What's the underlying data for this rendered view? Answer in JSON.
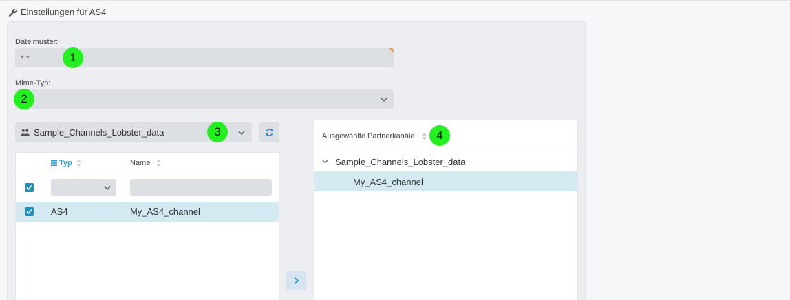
{
  "header": {
    "title": "Einstellungen für AS4",
    "icon": "wrench-icon"
  },
  "form": {
    "file_pattern": {
      "label": "Dateimuster:",
      "value": "*.*"
    },
    "mime_type": {
      "label": "Mime-Typ:",
      "value": ""
    }
  },
  "markers": [
    "1",
    "2",
    "3",
    "4"
  ],
  "channel_select": {
    "value": "Sample_Channels_Lobster_data",
    "icon": "group-icon"
  },
  "left_table": {
    "columns": [
      "Typ",
      "Name"
    ],
    "filter": {
      "typ": "",
      "name": ""
    },
    "rows": [
      {
        "typ": "AS4",
        "name": "My_AS4_channel",
        "checked": true
      }
    ]
  },
  "right_panel": {
    "title": "Ausgewählte Partnerkanäle",
    "group": "Sample_Channels_Lobster_data",
    "items": [
      "My_AS4_channel"
    ]
  },
  "colors": {
    "accent": "#1f8fc0",
    "selected_row": "#d4eaf2",
    "marker": "#22f11f",
    "field_bg": "#dcdfe4"
  }
}
